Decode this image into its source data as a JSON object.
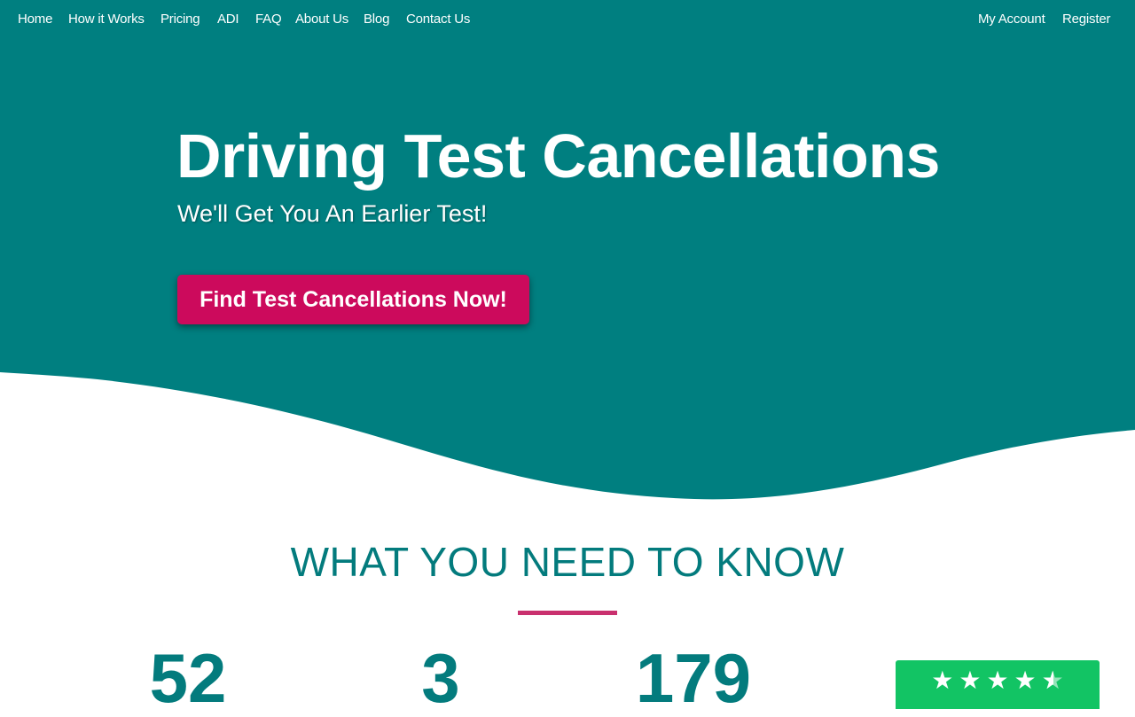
{
  "nav": {
    "left": [
      {
        "label": "Home"
      },
      {
        "label": "How it Works"
      },
      {
        "label": "Pricing"
      },
      {
        "label": "ADI"
      },
      {
        "label": "FAQ"
      },
      {
        "label": "About Us"
      },
      {
        "label": "Blog"
      },
      {
        "label": "Contact Us"
      }
    ],
    "right": [
      {
        "label": "My Account"
      },
      {
        "label": "Register"
      }
    ]
  },
  "hero": {
    "title": "Driving Test Cancellations",
    "subtitle": "We'll Get You An Earlier Test!",
    "cta_label": "Find Test Cancellations Now!"
  },
  "section": {
    "title": "WHAT YOU NEED TO KNOW"
  },
  "stats": [
    {
      "value": "52"
    },
    {
      "value": "3"
    },
    {
      "value": "179"
    }
  ],
  "rating": {
    "stars": 4.5,
    "icon": "star-icon"
  },
  "colors": {
    "hero_bg": "#007f80",
    "accent_button": "#cc0a5c",
    "heading_teal": "#037b7d",
    "divider_pink": "#c9306e",
    "rating_green": "#12c464"
  }
}
